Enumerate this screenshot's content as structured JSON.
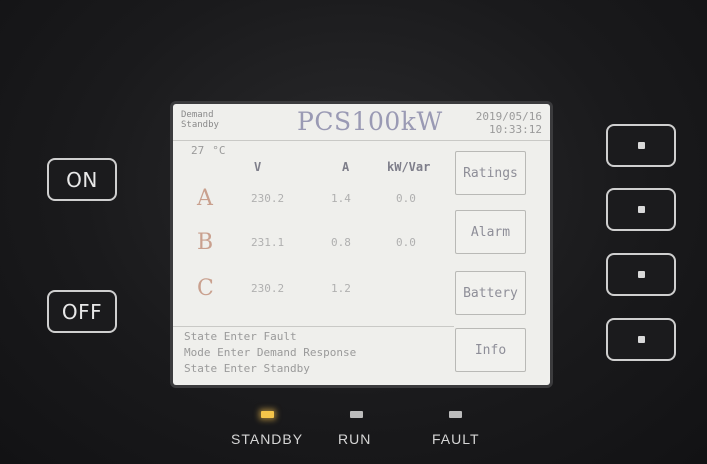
{
  "hardware": {
    "on_label": "ON",
    "off_label": "OFF"
  },
  "screen": {
    "status_lines": [
      "Demand",
      "Standby"
    ],
    "title": "PCS100kW",
    "date": "2019/05/16",
    "time": "10:33:12",
    "temperature": "27",
    "temperature_unit": "°C",
    "columns": [
      "V",
      "A",
      "kW/Var"
    ],
    "phases": [
      {
        "name": "A",
        "voltage": "230.2",
        "current": "1.4",
        "power": "0.0"
      },
      {
        "name": "B",
        "voltage": "231.1",
        "current": "0.8",
        "power": "0.0"
      },
      {
        "name": "C",
        "voltage": "230.2",
        "current": "1.2",
        "power": ""
      }
    ],
    "log": [
      "State Enter Fault",
      "Mode Enter Demand Response",
      "State Enter Standby"
    ],
    "menu": {
      "ratings": "Ratings",
      "alarm": "Alarm",
      "battery": "Battery",
      "info": "Info"
    }
  },
  "indicators": {
    "standby": {
      "label": "STANDBY",
      "color": "#f5c54a",
      "lit": true
    },
    "run": {
      "label": "RUN",
      "color": "#bcbcbc",
      "lit": false
    },
    "fault": {
      "label": "FAULT",
      "color": "#bcbcbc",
      "lit": false
    }
  },
  "icons": {
    "soft_key_marker": "square-dot-icon"
  }
}
